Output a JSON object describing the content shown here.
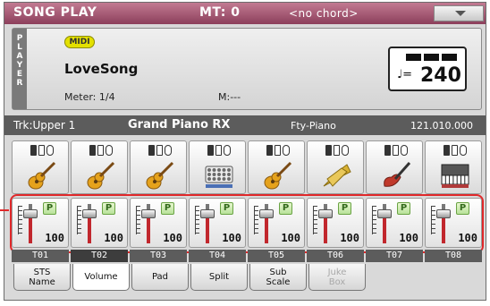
{
  "title_bar": {
    "mode": "SONG PLAY",
    "mt": "MT: 0",
    "chord": "<no chord>"
  },
  "player": {
    "tab_label": "P L A Y E R",
    "midi_badge": "MIDI",
    "song_name": "LoveSong",
    "meter": "Meter: 1/4",
    "measure": "M:---",
    "tempo_note": "♩=",
    "tempo_value": "240"
  },
  "track_info": {
    "track": "Trk:Upper 1",
    "sound": "Grand Piano RX",
    "bank": "Fty-Piano",
    "program": "121.010.000"
  },
  "instruments": [
    {
      "icon": "acoustic-guitar-icon",
      "color": "#e5a21c"
    },
    {
      "icon": "acoustic-guitar-icon",
      "color": "#e5a21c"
    },
    {
      "icon": "acoustic-guitar-icon",
      "color": "#e5a21c"
    },
    {
      "icon": "drum-kit-icon",
      "color": "#6b6b6b"
    },
    {
      "icon": "acoustic-guitar-icon",
      "color": "#e5a21c"
    },
    {
      "icon": "brass-icon",
      "color": "#d9b233"
    },
    {
      "icon": "bass-guitar-icon",
      "color": "#c0392b"
    },
    {
      "icon": "keyboard-icon",
      "color": "#b03a3a"
    }
  ],
  "channels": [
    {
      "label": "T01",
      "volume": "100",
      "play": "P",
      "level": 1.0
    },
    {
      "label": "T02",
      "volume": "100",
      "play": "P",
      "level": 1.0
    },
    {
      "label": "T03",
      "volume": "100",
      "play": "P",
      "level": 1.0
    },
    {
      "label": "T04",
      "volume": "100",
      "play": "P",
      "level": 1.0
    },
    {
      "label": "T05",
      "volume": "100",
      "play": "P",
      "level": 1.0
    },
    {
      "label": "T06",
      "volume": "100",
      "play": "P",
      "level": 1.0
    },
    {
      "label": "T07",
      "volume": "100",
      "play": "P",
      "level": 1.0
    },
    {
      "label": "T08",
      "volume": "100",
      "play": "P",
      "level": 1.0
    }
  ],
  "tabs": [
    {
      "label": "STS\nName",
      "state": "normal"
    },
    {
      "label": "Volume",
      "state": "active"
    },
    {
      "label": "Pad",
      "state": "normal"
    },
    {
      "label": "Split",
      "state": "normal"
    },
    {
      "label": "Sub\nScale",
      "state": "normal"
    },
    {
      "label": "Juke\nBox",
      "state": "disabled"
    }
  ],
  "colors": {
    "title_bar": "#8c3f5b",
    "highlight": "#e0282a",
    "fader_fill": "#c1272d",
    "play_button": "#b8e29a"
  }
}
